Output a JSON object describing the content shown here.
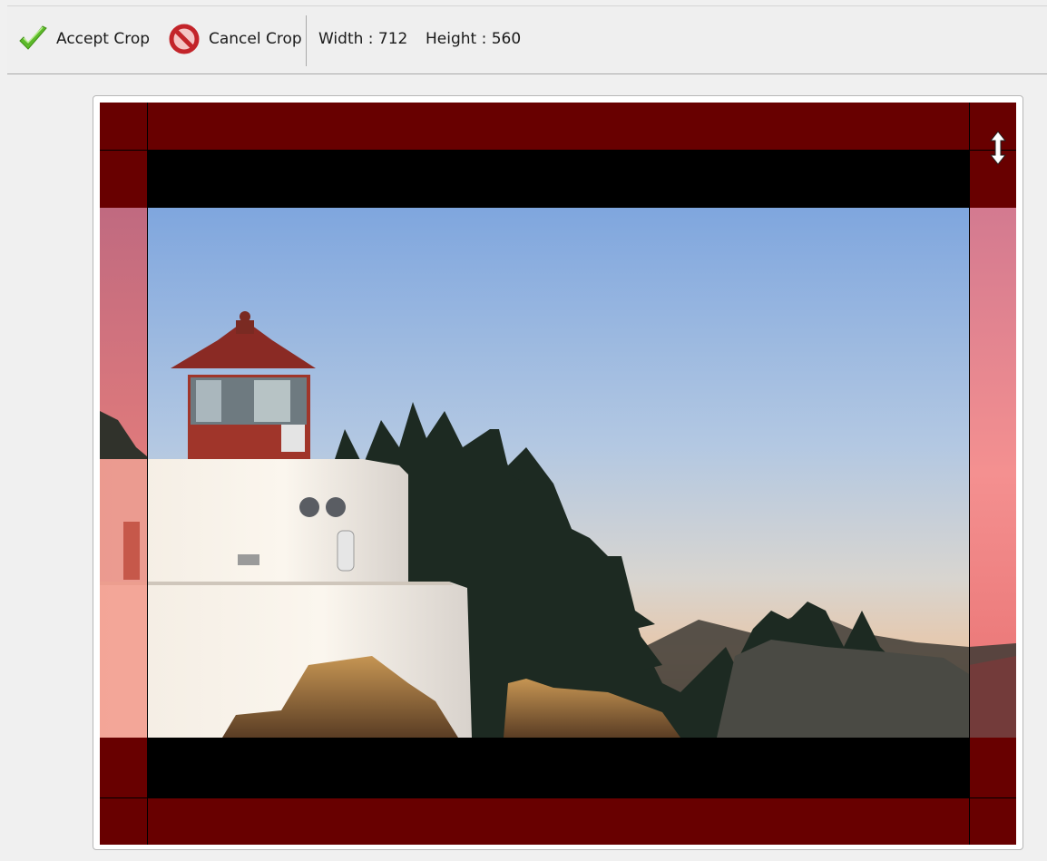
{
  "toolbar": {
    "accept_label": "Accept Crop",
    "cancel_label": "Cancel Crop",
    "width_label": "Width : 712",
    "height_label": "Height : 560",
    "accept_icon": "checkmark-icon",
    "cancel_icon": "no-entry-icon"
  },
  "crop": {
    "handle_icon": "vertical-resize-icon"
  },
  "colors": {
    "overlay": "#680000",
    "accept_green": "#5dbb2a",
    "cancel_red": "#d9343a"
  }
}
